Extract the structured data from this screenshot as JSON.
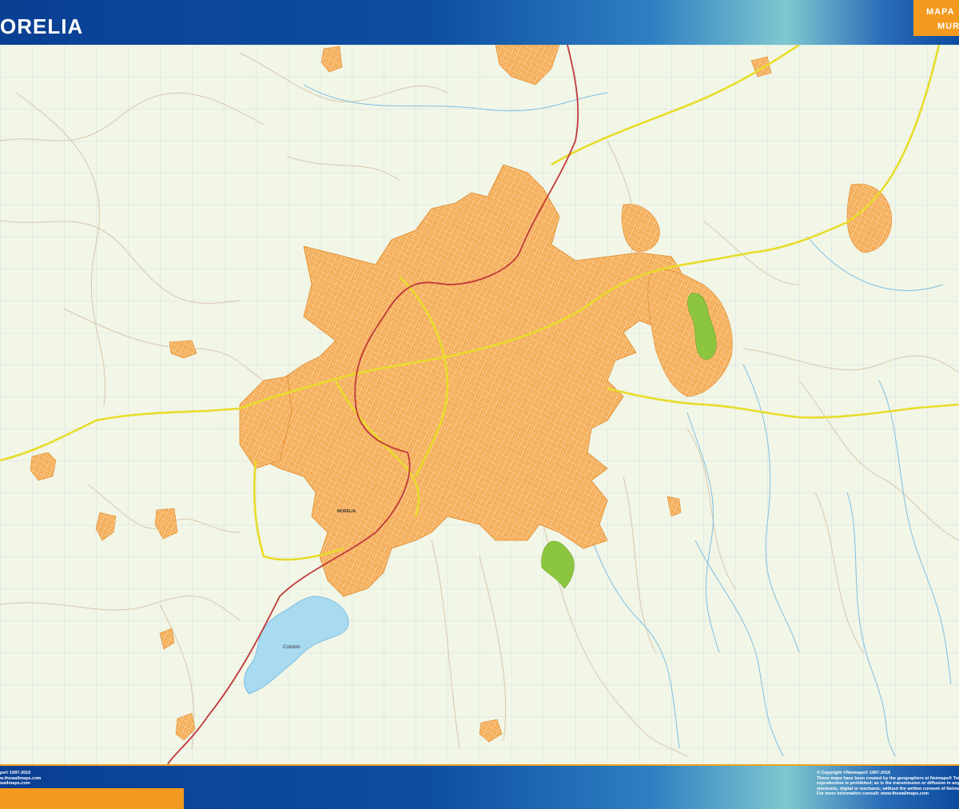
{
  "header": {
    "title": "ORELIA",
    "badge_line1": "MAPA",
    "badge_line2": "MUR"
  },
  "map": {
    "lake_label": "Cointzio",
    "city_label": "MORELIA",
    "colors": {
      "background": "#f1f6e6",
      "urban": "#f4a94f",
      "park": "#8cc63f",
      "water": "#a8daf0",
      "highway": "#e8dc2a",
      "railway": "#c0393b",
      "grid": "#c9d9e8",
      "header_blue": "#0d4ea3",
      "accent_orange": "#f39a1f"
    }
  },
  "footer": {
    "left_lines": [
      "ps® 1997-2016",
      "w.thewallmaps.com",
      "wallmaps.com"
    ],
    "right_lines": [
      "© Copyright ©Netmaps® 1997-2016",
      "These maps have been created by the geographers at Netmaps® Tot",
      "reproduction is prohibited; as is the transmission or diffusion in any",
      "electronic, digital or mechanic; without the written consent of Netma",
      "For more information consult: www.thewallmaps.com"
    ]
  }
}
